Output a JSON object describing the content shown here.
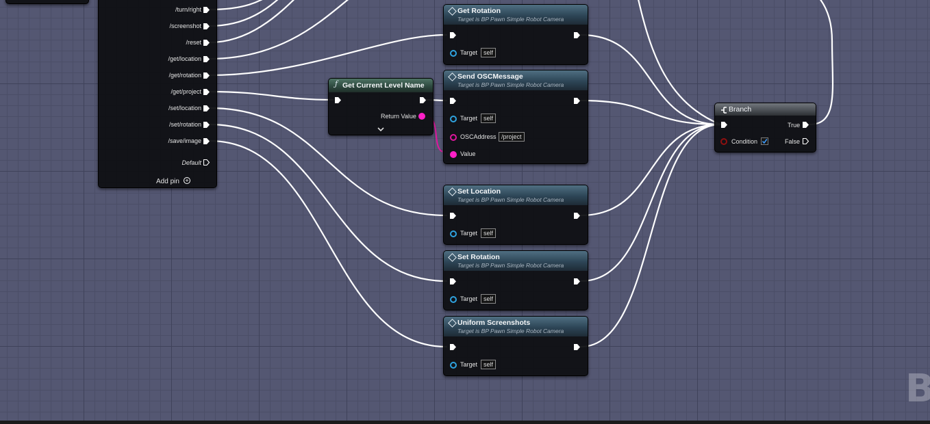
{
  "switch_node": {
    "outputs": [
      "/turn/right",
      "/screenshot",
      "/reset",
      "/get/location",
      "/get/rotation",
      "/get/project",
      "/set/location",
      "/set/rotation",
      "/save/image"
    ],
    "default_label": "Default",
    "add_pin_label": "Add pin"
  },
  "get_level_node": {
    "title": "Get Current Level Name",
    "return_label": "Return Value"
  },
  "function_nodes": [
    {
      "id": "get-rotation",
      "title": "Get Rotation",
      "subtitle": "Target is BP Pawn Simple Robot Camera",
      "target_label": "Target",
      "target_value": "self"
    },
    {
      "id": "send-osc-message",
      "title": "Send OSCMessage",
      "subtitle": "Target is BP Pawn Simple Robot Camera",
      "target_label": "Target",
      "target_value": "self",
      "address_label": "OSCAddress",
      "address_value": "/project",
      "value_label": "Value"
    },
    {
      "id": "set-location",
      "title": "Set Location",
      "subtitle": "Target is BP Pawn Simple Robot Camera",
      "target_label": "Target",
      "target_value": "self"
    },
    {
      "id": "set-rotation",
      "title": "Set Rotation",
      "subtitle": "Target is BP Pawn Simple Robot Camera",
      "target_label": "Target",
      "target_value": "self"
    },
    {
      "id": "uniform-screenshots",
      "title": "Uniform Screenshots",
      "subtitle": "Target is BP Pawn Simple Robot Camera",
      "target_label": "Target",
      "target_value": "self"
    }
  ],
  "branch_node": {
    "title": "Branch",
    "condition_label": "Condition",
    "condition_checked": true,
    "true_label": "True",
    "false_label": "False"
  },
  "watermark": "B",
  "colors": {
    "graph_background": "#545772",
    "exec_wire": "#ffffff",
    "string_pin": "#ff20c7",
    "object_pin": "#2fa3e0",
    "bool_pin": "#8f1010",
    "function_header": "#2d4556"
  },
  "icons": {
    "function_header": "diamond-function-icon",
    "pure_function_header": "f-function-icon",
    "branch_header": "branch-icon",
    "add_pin": "plus-circle-icon",
    "expand": "chevron-down-icon",
    "exec_pin": "exec-arrow-icon"
  }
}
